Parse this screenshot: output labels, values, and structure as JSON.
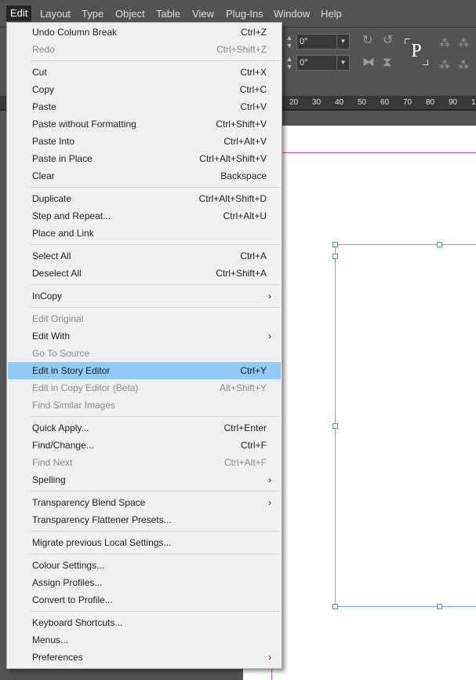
{
  "menubar": {
    "items": [
      "Edit",
      "Layout",
      "Type",
      "Object",
      "Table",
      "View",
      "Plug-Ins",
      "Window",
      "Help"
    ],
    "active": "Edit"
  },
  "control": {
    "angle1": "0°",
    "angle2": "0°",
    "p_label": "P"
  },
  "ruler": {
    "labels": [
      "20",
      "30",
      "40",
      "50",
      "60",
      "70",
      "80",
      "90",
      "1"
    ]
  },
  "menu": {
    "items": [
      {
        "label": "Undo Column Break",
        "shortcut": "Ctrl+Z",
        "disabled": false
      },
      {
        "label": "Redo",
        "shortcut": "Ctrl+Shift+Z",
        "disabled": true
      },
      {
        "label": "Cut",
        "shortcut": "Ctrl+X",
        "disabled": false
      },
      {
        "label": "Copy",
        "shortcut": "Ctrl+C",
        "disabled": false
      },
      {
        "label": "Paste",
        "shortcut": "Ctrl+V",
        "disabled": false
      },
      {
        "label": "Paste without Formatting",
        "shortcut": "Ctrl+Shift+V",
        "disabled": false
      },
      {
        "label": "Paste Into",
        "shortcut": "Ctrl+Alt+V",
        "disabled": false
      },
      {
        "label": "Paste in Place",
        "shortcut": "Ctrl+Alt+Shift+V",
        "disabled": false
      },
      {
        "label": "Clear",
        "shortcut": "Backspace",
        "disabled": false
      },
      {
        "label": "Duplicate",
        "shortcut": "Ctrl+Alt+Shift+D",
        "disabled": false
      },
      {
        "label": "Step and Repeat...",
        "shortcut": "Ctrl+Alt+U",
        "disabled": false
      },
      {
        "label": "Place and Link",
        "shortcut": "",
        "disabled": false
      },
      {
        "label": "Select All",
        "shortcut": "Ctrl+A",
        "disabled": false
      },
      {
        "label": "Deselect All",
        "shortcut": "Ctrl+Shift+A",
        "disabled": false
      },
      {
        "label": "InCopy",
        "shortcut": "",
        "submenu": true,
        "disabled": false
      },
      {
        "label": "Edit Original",
        "shortcut": "",
        "disabled": true
      },
      {
        "label": "Edit With",
        "shortcut": "",
        "submenu": true,
        "disabled": false
      },
      {
        "label": "Go To Source",
        "shortcut": "",
        "disabled": true
      },
      {
        "label": "Edit in Story Editor",
        "shortcut": "Ctrl+Y",
        "disabled": false,
        "highlighted": true
      },
      {
        "label": "Edit in Copy Editor (Beta)",
        "shortcut": "Alt+Shift+Y",
        "disabled": true
      },
      {
        "label": "Find Similar Images",
        "shortcut": "",
        "disabled": true
      },
      {
        "label": "Quick Apply...",
        "shortcut": "Ctrl+Enter",
        "disabled": false
      },
      {
        "label": "Find/Change...",
        "shortcut": "Ctrl+F",
        "disabled": false
      },
      {
        "label": "Find Next",
        "shortcut": "Ctrl+Alt+F",
        "disabled": true
      },
      {
        "label": "Spelling",
        "shortcut": "",
        "submenu": true,
        "disabled": false
      },
      {
        "label": "Transparency Blend Space",
        "shortcut": "",
        "submenu": true,
        "disabled": false
      },
      {
        "label": "Transparency Flattener Presets...",
        "shortcut": "",
        "disabled": false
      },
      {
        "label": "Migrate previous Local Settings...",
        "shortcut": "",
        "disabled": false
      },
      {
        "label": "Colour Settings...",
        "shortcut": "",
        "disabled": false
      },
      {
        "label": "Assign Profiles...",
        "shortcut": "",
        "disabled": false
      },
      {
        "label": "Convert to Profile...",
        "shortcut": "",
        "disabled": false
      },
      {
        "label": "Keyboard Shortcuts...",
        "shortcut": "",
        "disabled": false
      },
      {
        "label": "Menus...",
        "shortcut": "",
        "disabled": false
      },
      {
        "label": "Preferences",
        "shortcut": "",
        "submenu": true,
        "disabled": false
      }
    ]
  }
}
